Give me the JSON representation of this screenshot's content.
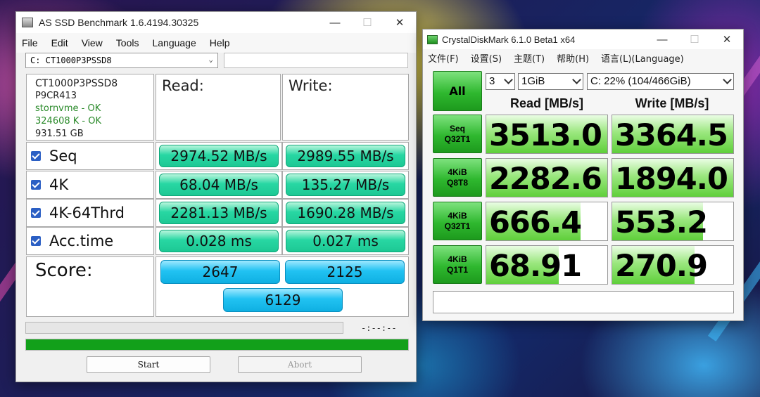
{
  "colors": {
    "as_result_pill": "#28d7a3",
    "as_score_pill": "#21c2f2",
    "as_progress": "#12a01a",
    "cdm_green": "#2fb82f",
    "cdm_bar": "#5fcf3a"
  },
  "as_ssd": {
    "title": "AS SSD Benchmark 1.6.4194.30325",
    "menu": [
      "File",
      "Edit",
      "View",
      "Tools",
      "Language",
      "Help"
    ],
    "drive_select": "C: CT1000P3PSSD8",
    "info": {
      "model": "CT1000P3PSSD8",
      "firmware": "P9CR413",
      "driver": "stornvme - OK",
      "alignment": "324608 K - OK",
      "size": "931.51 GB"
    },
    "headers": {
      "read": "Read:",
      "write": "Write:"
    },
    "rows": [
      {
        "label": "Seq",
        "read": "2974.52 MB/s",
        "write": "2989.55 MB/s"
      },
      {
        "label": "4K",
        "read": "68.04 MB/s",
        "write": "135.27 MB/s"
      },
      {
        "label": "4K-64Thrd",
        "read": "2281.13 MB/s",
        "write": "1690.28 MB/s"
      },
      {
        "label": "Acc.time",
        "read": "0.028 ms",
        "write": "0.027 ms"
      }
    ],
    "score": {
      "label": "Score:",
      "read": "2647",
      "write": "2125",
      "total": "6129"
    },
    "elapsed_time": "-:--:--",
    "progress_fraction": 1.0,
    "buttons": {
      "start": "Start",
      "abort": "Abort"
    }
  },
  "cdm": {
    "title": "CrystalDiskMark 6.1.0 Beta1 x64",
    "menu": [
      "文件(F)",
      "设置(S)",
      "主题(T)",
      "帮助(H)",
      "语言(L)(Language)"
    ],
    "all_button": "All",
    "count_select": "3",
    "size_select": "1GiB",
    "drive_select": "C: 22% (104/466GiB)",
    "headers": {
      "read": "Read [MB/s]",
      "write": "Write [MB/s]"
    },
    "rows": [
      {
        "label_top": "Seq",
        "label_bottom": "Q32T1",
        "read": "3513.0",
        "write": "3364.5",
        "read_fill": 1.0,
        "write_fill": 1.0
      },
      {
        "label_top": "4KiB",
        "label_bottom": "Q8T8",
        "read": "2282.6",
        "write": "1894.0",
        "read_fill": 1.0,
        "write_fill": 1.0
      },
      {
        "label_top": "4KiB",
        "label_bottom": "Q32T1",
        "read": "666.4",
        "write": "553.2",
        "read_fill": 0.78,
        "write_fill": 0.75
      },
      {
        "label_top": "4KiB",
        "label_bottom": "Q1T1",
        "read": "68.91",
        "write": "270.9",
        "read_fill": 0.6,
        "write_fill": 0.68
      }
    ],
    "comment": ""
  }
}
